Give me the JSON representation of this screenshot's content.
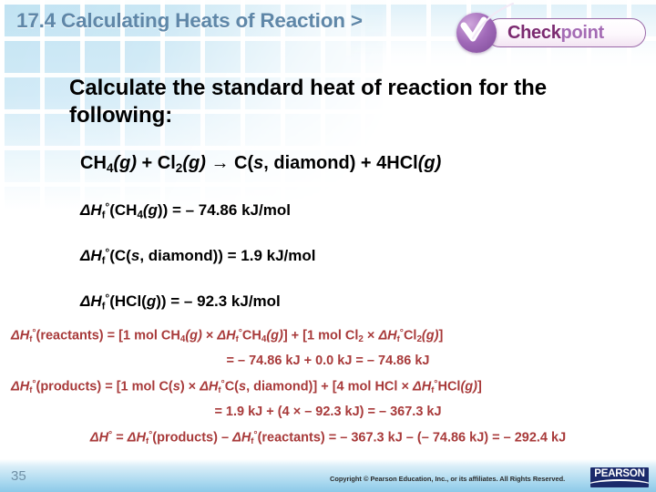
{
  "header": {
    "title": "17.4 Calculating Heats of Reaction >",
    "badge": {
      "word_1": "Check",
      "word_2": "point",
      "check_icon": "check-icon",
      "circle_color": "#a069b8",
      "word_1_color": "#7b2a70",
      "word_2_color": "#a46bb4"
    }
  },
  "body": {
    "prompt": "Calculate the standard heat of reaction for the following:",
    "equation": {
      "reactant_1": "CH",
      "reactant_1_sub": "4",
      "reactant_1_state": "(g)",
      "plus_1": " + ",
      "reactant_2": "Cl",
      "reactant_2_sub": "2",
      "reactant_2_state": "(g)",
      "arrow": " → ",
      "product_1": "C(",
      "product_1_state": "s",
      "product_1_rest": ", diamond)",
      "plus_2": " + ",
      "product_2": "4HCl",
      "product_2_state": "(g)"
    },
    "enthalpies": [
      {
        "symbol": "ΔH",
        "sub": "f",
        "deg": "°",
        "species": "(CH",
        "species_sub": "4",
        "species_state": "(g",
        "close": "))",
        "equals": " = – 74.86 k",
        "unit": "J/mol",
        "value": -74.86,
        "units": "kJ/mol"
      },
      {
        "symbol": "ΔH",
        "sub": "f",
        "deg": "°",
        "species": "(C(",
        "species_state": "s",
        "species_rest": ", diamond))",
        "equals": " = 1.9 kJ/mol",
        "value": 1.9,
        "units": "kJ/mol"
      },
      {
        "symbol": "ΔH",
        "sub": "f",
        "deg": "°",
        "species": "(HCl(",
        "species_state": "g",
        "species_rest": "))",
        "equals": " = – 92.3 kJ/mol",
        "value": -92.3,
        "units": "kJ/mol"
      }
    ],
    "calculations": {
      "reactants_line": "ΔHf°(reactants) = [1 mol CH4(g) × ΔHf°CH4(g)] + [1 mol Cl2 × ΔHf°Cl2(g)]",
      "reactants_value": "= – 74.86 kJ + 0.0 kJ = – 74.86 kJ",
      "products_line": "ΔHf°(products) = [1 mol C(s) × ΔHf°C(s, diamond)] + [4 mol HCl × ΔHf°HCl(g)]",
      "products_value": "= 1.9 kJ + (4 × – 92.3 kJ) = – 367.3 kJ",
      "total_line": "ΔH° = ΔHf°(products) – ΔHf°(reactants) = – 367.3 kJ – (– 74.86 kJ) = – 292.4 kJ",
      "reactants_total_kj": -74.86,
      "products_total_kj": -367.3,
      "delta_h_rxn_kj": -292.4,
      "text_color": "#a83a3a"
    }
  },
  "footer": {
    "slide_number": "35",
    "copyright": "Copyright © Pearson Education, Inc., or its affiliates. All Rights Reserved.",
    "logo_text": "PEARSON"
  }
}
